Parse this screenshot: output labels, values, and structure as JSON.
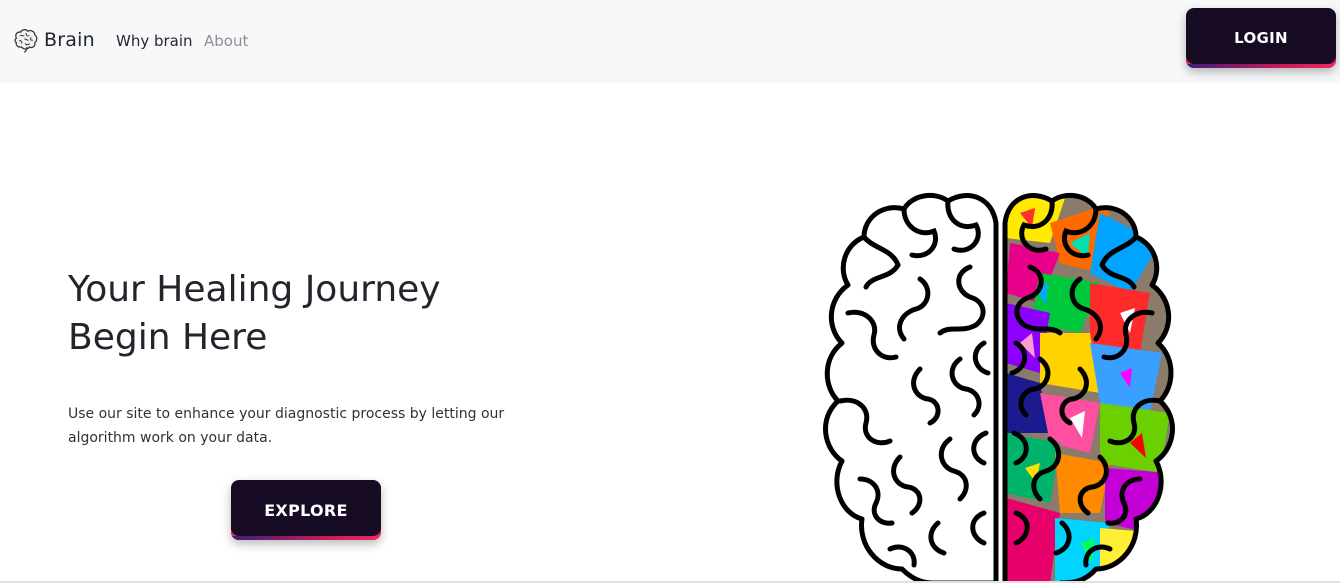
{
  "nav": {
    "brand": "Brain",
    "brand_icon": "brain-icon",
    "links": [
      "Why brain",
      "About"
    ],
    "login_label": "LOGIN"
  },
  "hero": {
    "title_line1": "Your Healing Journey",
    "title_line2": "Begin Here",
    "description": "Use our site to enhance your diagnostic process by letting our algorithm work on your data.",
    "explore_label": "EXPLORE",
    "illustration": "brain-illustration"
  },
  "colors": {
    "button_bg": "#170b24",
    "button_accent": "#e8265f",
    "navbar_bg": "#f7f8fa",
    "text": "#22252b"
  }
}
